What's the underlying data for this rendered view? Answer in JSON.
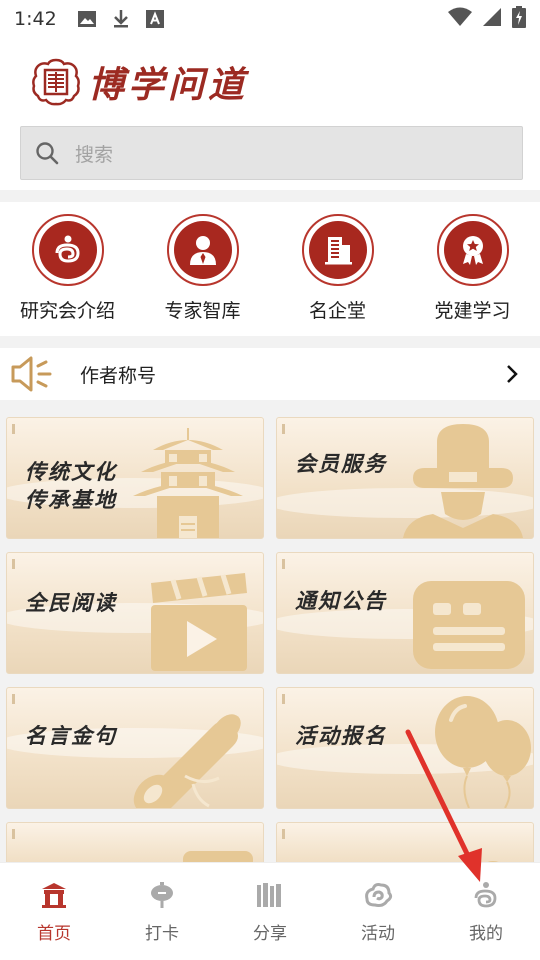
{
  "status_bar": {
    "time": "1:42",
    "left_icons": [
      "image-icon",
      "download-icon",
      "font-icon"
    ],
    "right_icons": [
      "wifi-icon",
      "signal-icon",
      "battery-icon"
    ]
  },
  "header": {
    "app_title": "博学问道",
    "search_placeholder": "搜索"
  },
  "quick_nav": [
    {
      "label": "研究会介绍",
      "icon": "swirl-icon"
    },
    {
      "label": "专家智库",
      "icon": "person-icon"
    },
    {
      "label": "名企堂",
      "icon": "building-icon"
    },
    {
      "label": "党建学习",
      "icon": "badge-icon"
    }
  ],
  "notice": {
    "text": "作者称号",
    "icon": "speaker-icon"
  },
  "cards": [
    {
      "lines": [
        "传统文化",
        "传承基地"
      ],
      "art": "pagoda-art"
    },
    {
      "lines": [
        "会员服务"
      ],
      "art": "official-art"
    },
    {
      "lines": [
        "全民阅读"
      ],
      "art": "video-art"
    },
    {
      "lines": [
        "通知公告"
      ],
      "art": "message-art"
    },
    {
      "lines": [
        "名言金句"
      ],
      "art": "scroll-art"
    },
    {
      "lines": [
        "活动报名"
      ],
      "art": "balloon-art"
    }
  ],
  "tabs": [
    {
      "label": "首页",
      "icon": "home-icon",
      "active": true
    },
    {
      "label": "打卡",
      "icon": "lantern-icon",
      "active": false
    },
    {
      "label": "分享",
      "icon": "books-icon",
      "active": false
    },
    {
      "label": "活动",
      "icon": "cloud-icon",
      "active": false
    },
    {
      "label": "我的",
      "icon": "profile-icon",
      "active": false
    }
  ],
  "colors": {
    "brand_red": "#b8362d",
    "card_beige": "#f2e1c8",
    "annotation_arrow": "#e0322b"
  }
}
